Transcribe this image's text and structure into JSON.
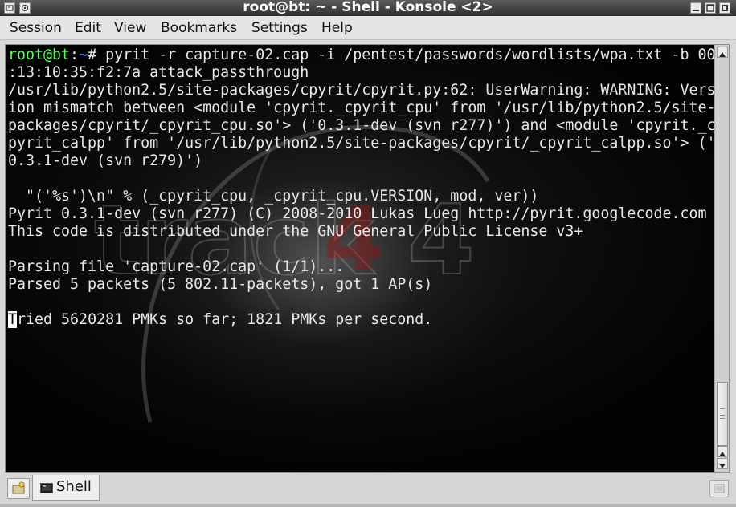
{
  "window": {
    "title": "root@bt: ~ - Shell - Konsole <2>"
  },
  "menu": {
    "items": [
      "Session",
      "Edit",
      "View",
      "Bookmarks",
      "Settings",
      "Help"
    ]
  },
  "terminal": {
    "prompt_user": "root@bt",
    "prompt_sep": ":",
    "prompt_path": "~",
    "prompt_end": "# ",
    "command": "pyrit -r capture-02.cap -i /pentest/passwords/wordlists/wpa.txt -b 00",
    "lines": [
      ":13:10:35:f2:7a attack_passthrough",
      "/usr/lib/python2.5/site-packages/cpyrit/cpyrit.py:62: UserWarning: WARNING: Vers",
      "ion mismatch between <module 'cpyrit._cpyrit_cpu' from '/usr/lib/python2.5/site-",
      "packages/cpyrit/_cpyrit_cpu.so'> ('0.3.1-dev (svn r277)') and <module 'cpyrit._c",
      "pyrit_calpp' from '/usr/lib/python2.5/site-packages/cpyrit/_cpyrit_calpp.so'> ('",
      "0.3.1-dev (svn r279)')",
      "",
      "  \"('%s')\\n\" % (_cpyrit_cpu, _cpyrit_cpu.VERSION, mod, ver))",
      "Pyrit 0.3.1-dev (svn r277) (C) 2008-2010 Lukas Lueg http://pyrit.googlecode.com",
      "This code is distributed under the GNU General Public License v3+",
      "",
      "Parsing file 'capture-02.cap' (1/1)...",
      "Parsed 5 packets (5 802.11-packets), got 1 AP(s)",
      ""
    ],
    "cursor_char": "T",
    "last_line_rest": "ried 5620281 PMKs so far; 1821 PMKs per second.",
    "background_text": "track 4"
  },
  "tabs": {
    "items": [
      {
        "label": "Shell",
        "icon": "terminal-icon",
        "active": true
      }
    ],
    "new_tab_icon": "new-session-icon",
    "close_tab_icon": "close-tab-icon"
  },
  "colors": {
    "prompt_user": "#54ff54",
    "prompt_path": "#5b8cff",
    "text": "#e8e8e8",
    "background": "#020202"
  }
}
